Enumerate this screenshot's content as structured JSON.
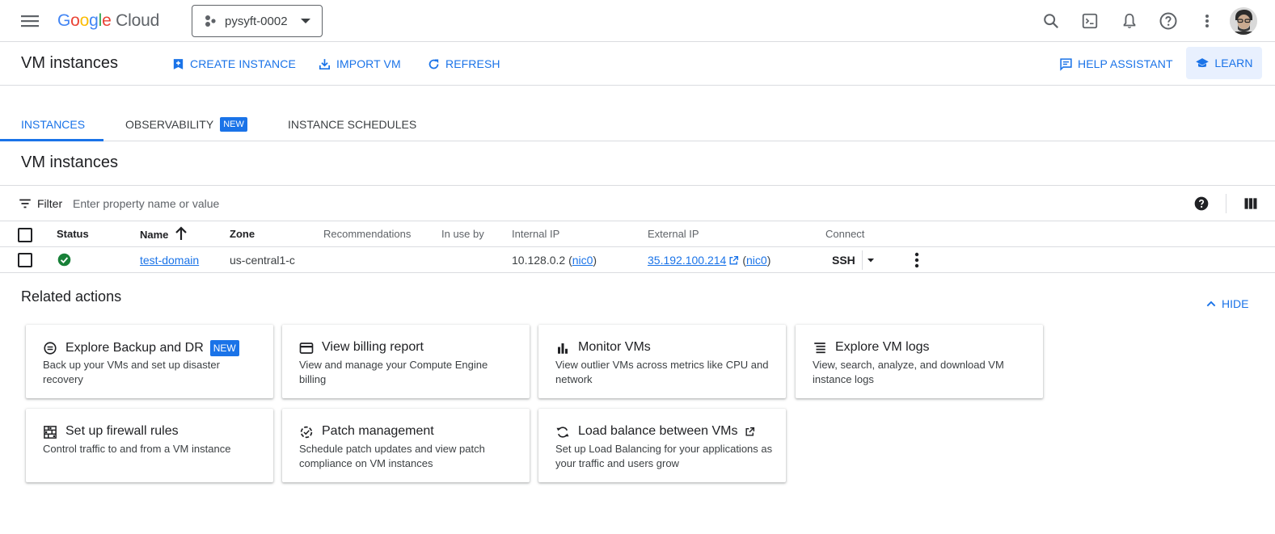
{
  "header": {
    "logo_text": "Google Cloud",
    "project_name": "pysyft-0002"
  },
  "toolbar": {
    "page_title": "VM instances",
    "create_label": "CREATE INSTANCE",
    "import_label": "IMPORT VM",
    "refresh_label": "REFRESH",
    "help_label": "HELP ASSISTANT",
    "learn_label": "LEARN"
  },
  "tabs": [
    {
      "label": "INSTANCES",
      "active": true
    },
    {
      "label": "OBSERVABILITY",
      "badge": "NEW"
    },
    {
      "label": "INSTANCE SCHEDULES"
    }
  ],
  "section_title": "VM instances",
  "filter": {
    "label": "Filter",
    "placeholder": "Enter property name or value"
  },
  "table": {
    "columns": [
      "Status",
      "Name",
      "Zone",
      "Recommendations",
      "In use by",
      "Internal IP",
      "External IP",
      "Connect"
    ],
    "rows": [
      {
        "status": "running",
        "name": "test-domain",
        "zone": "us-central1-c",
        "recommendations": "",
        "in_use_by": "",
        "internal_ip": "10.128.0.2",
        "internal_nic": "nic0",
        "external_ip": "35.192.100.214",
        "external_nic": "nic0",
        "connect": "SSH"
      }
    ]
  },
  "related": {
    "title": "Related actions",
    "hide_label": "HIDE",
    "cards": [
      {
        "title": "Explore Backup and DR",
        "badge": "NEW",
        "desc": "Back up your VMs and set up disaster recovery",
        "icon": "backup-icon"
      },
      {
        "title": "View billing report",
        "desc": "View and manage your Compute Engine billing",
        "icon": "billing-card-icon"
      },
      {
        "title": "Monitor VMs",
        "desc": "View outlier VMs across metrics like CPU and network",
        "icon": "bar-chart-icon"
      },
      {
        "title": "Explore VM logs",
        "desc": "View, search, analyze, and download VM instance logs",
        "icon": "logs-icon"
      },
      {
        "title": "Set up firewall rules",
        "desc": "Control traffic to and from a VM instance",
        "icon": "firewall-icon"
      },
      {
        "title": "Patch management",
        "desc": "Schedule patch updates and view patch compliance on VM instances",
        "icon": "patch-icon"
      },
      {
        "title": "Load balance between VMs",
        "desc": "Set up Load Balancing for your applications as your traffic and users grow",
        "icon": "load-balance-icon",
        "external": true
      }
    ]
  },
  "colors": {
    "accent": "#1a73e8",
    "status_ok": "#188038",
    "border": "#dadce0"
  }
}
